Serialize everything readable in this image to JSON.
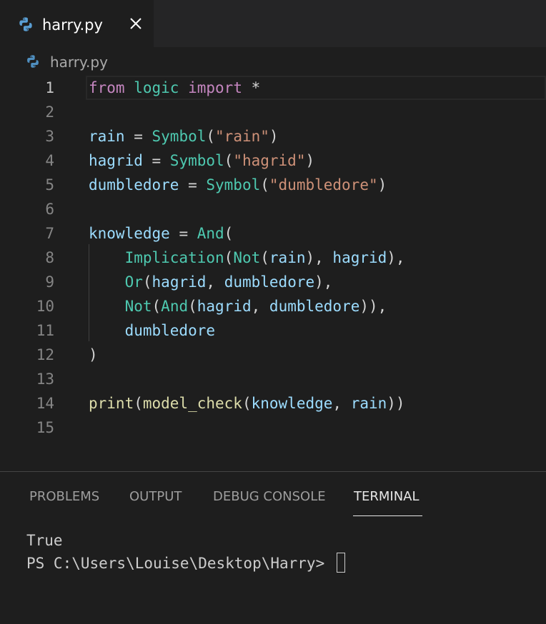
{
  "tab": {
    "label": "harry.py"
  },
  "breadcrumb": {
    "label": "harry.py"
  },
  "editor": {
    "lines": [
      {
        "num": "1",
        "tokens": [
          [
            "kw",
            "from"
          ],
          [
            "op",
            " "
          ],
          [
            "mod",
            "logic"
          ],
          [
            "op",
            " "
          ],
          [
            "kw",
            "import"
          ],
          [
            "op",
            " *"
          ]
        ]
      },
      {
        "num": "2",
        "tokens": []
      },
      {
        "num": "3",
        "tokens": [
          [
            "var",
            "rain"
          ],
          [
            "op",
            " = "
          ],
          [
            "cls",
            "Symbol"
          ],
          [
            "op",
            "("
          ],
          [
            "str",
            "\"rain\""
          ],
          [
            "op",
            ")"
          ]
        ]
      },
      {
        "num": "4",
        "tokens": [
          [
            "var",
            "hagrid"
          ],
          [
            "op",
            " = "
          ],
          [
            "cls",
            "Symbol"
          ],
          [
            "op",
            "("
          ],
          [
            "str",
            "\"hagrid\""
          ],
          [
            "op",
            ")"
          ]
        ]
      },
      {
        "num": "5",
        "tokens": [
          [
            "var",
            "dumbledore"
          ],
          [
            "op",
            " = "
          ],
          [
            "cls",
            "Symbol"
          ],
          [
            "op",
            "("
          ],
          [
            "str",
            "\"dumbledore\""
          ],
          [
            "op",
            ")"
          ]
        ]
      },
      {
        "num": "6",
        "tokens": []
      },
      {
        "num": "7",
        "tokens": [
          [
            "var",
            "knowledge"
          ],
          [
            "op",
            " = "
          ],
          [
            "cls",
            "And"
          ],
          [
            "op",
            "("
          ]
        ]
      },
      {
        "num": "8",
        "tokens": [
          [
            "op",
            "    "
          ],
          [
            "cls",
            "Implication"
          ],
          [
            "op",
            "("
          ],
          [
            "cls",
            "Not"
          ],
          [
            "op",
            "("
          ],
          [
            "var",
            "rain"
          ],
          [
            "op",
            "), "
          ],
          [
            "var",
            "hagrid"
          ],
          [
            "op",
            "),"
          ]
        ]
      },
      {
        "num": "9",
        "tokens": [
          [
            "op",
            "    "
          ],
          [
            "cls",
            "Or"
          ],
          [
            "op",
            "("
          ],
          [
            "var",
            "hagrid"
          ],
          [
            "op",
            ", "
          ],
          [
            "var",
            "dumbledore"
          ],
          [
            "op",
            "),"
          ]
        ]
      },
      {
        "num": "10",
        "tokens": [
          [
            "op",
            "    "
          ],
          [
            "cls",
            "Not"
          ],
          [
            "op",
            "("
          ],
          [
            "cls",
            "And"
          ],
          [
            "op",
            "("
          ],
          [
            "var",
            "hagrid"
          ],
          [
            "op",
            ", "
          ],
          [
            "var",
            "dumbledore"
          ],
          [
            "op",
            ")),"
          ]
        ]
      },
      {
        "num": "11",
        "tokens": [
          [
            "op",
            "    "
          ],
          [
            "var",
            "dumbledore"
          ]
        ]
      },
      {
        "num": "12",
        "tokens": [
          [
            "op",
            ")"
          ]
        ]
      },
      {
        "num": "13",
        "tokens": []
      },
      {
        "num": "14",
        "tokens": [
          [
            "fn",
            "print"
          ],
          [
            "op",
            "("
          ],
          [
            "fn",
            "model_check"
          ],
          [
            "op",
            "("
          ],
          [
            "var",
            "knowledge"
          ],
          [
            "op",
            ", "
          ],
          [
            "var",
            "rain"
          ],
          [
            "op",
            "))"
          ]
        ]
      },
      {
        "num": "15",
        "tokens": []
      }
    ],
    "active_line": "1"
  },
  "panel": {
    "tabs": {
      "problems": "PROBLEMS",
      "output": "OUTPUT",
      "debug_console": "DEBUG CONSOLE",
      "terminal": "TERMINAL"
    },
    "active_tab": "TERMINAL",
    "terminal": {
      "output": "True",
      "prompt": "PS C:\\Users\\Louise\\Desktop\\Harry> "
    }
  },
  "colors": {
    "background": "#1e1e1e",
    "tabbar": "#252526",
    "keyword": "#c586c0",
    "class": "#4ec9b0",
    "variable": "#9cdcfe",
    "string": "#ce9178",
    "function": "#dcdcaa"
  },
  "icons": {
    "tab": "python-icon",
    "breadcrumb": "python-icon",
    "close": "close-icon"
  }
}
